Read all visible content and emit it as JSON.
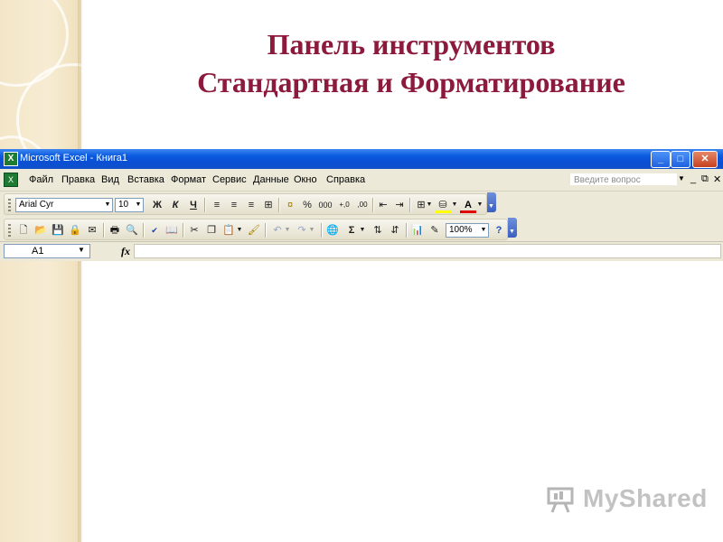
{
  "slide": {
    "title_line1": "Панель инструментов",
    "title_line2": "Стандартная и Форматирование"
  },
  "window": {
    "title": "Microsoft Excel - Книга1",
    "app_icon": "excel-icon",
    "controls": [
      "minimize-icon",
      "maximize-icon",
      "close-icon"
    ]
  },
  "menubar": {
    "items": [
      "Файл",
      "Правка",
      "Вид",
      "Вставка",
      "Формат",
      "Сервис",
      "Данные",
      "Окно",
      "Справка"
    ],
    "help_placeholder": "Введите вопрос"
  },
  "formatting_toolbar": {
    "font": "Arial Cyr",
    "size": "10",
    "bold": "Ж",
    "italic": "К",
    "underline": "Ч",
    "percent": "%",
    "thousands": "000",
    "inc_decimal": "+,0",
    "dec_decimal": ",00",
    "font_color_letter": "A"
  },
  "standard_toolbar": {
    "sigma": "Σ",
    "zoom": "100%"
  },
  "formula_bar": {
    "cell_ref": "A1",
    "fx": "fx"
  },
  "watermark": {
    "text": "MyShared"
  },
  "colors": {
    "title": "#8b1a3c",
    "titlebar": "#0b4fd3",
    "toolbar_bg": "#ece9d8",
    "deco": "#f3e6c8"
  }
}
